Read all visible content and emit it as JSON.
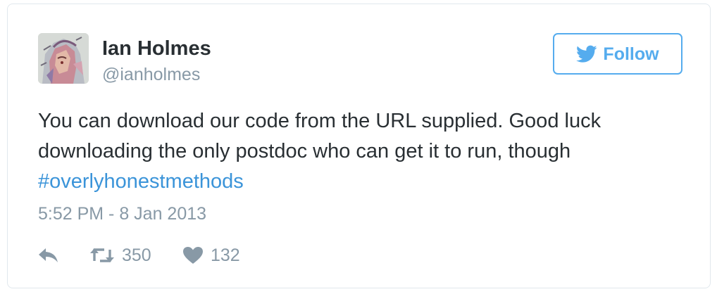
{
  "tweet": {
    "author_name": "Ian Holmes",
    "author_handle": "@ianholmes",
    "text_before": "You can download our code from the URL supplied. Good luck downloading the only postdoc who can get it to run, though ",
    "hashtag": "#overlyhonestmethods",
    "timestamp": "5:52 PM - 8 Jan 2013",
    "retweet_count": "350",
    "like_count": "132"
  },
  "follow_button": {
    "label": "Follow"
  },
  "icons": {
    "bird": "twitter-bird-icon",
    "reply": "reply-icon",
    "retweet": "retweet-icon",
    "like": "heart-icon"
  },
  "colors": {
    "accent": "#55acee",
    "hashtag": "#3b94d9",
    "muted": "#8899a6",
    "text": "#292f33",
    "border": "#e1e8ed"
  }
}
